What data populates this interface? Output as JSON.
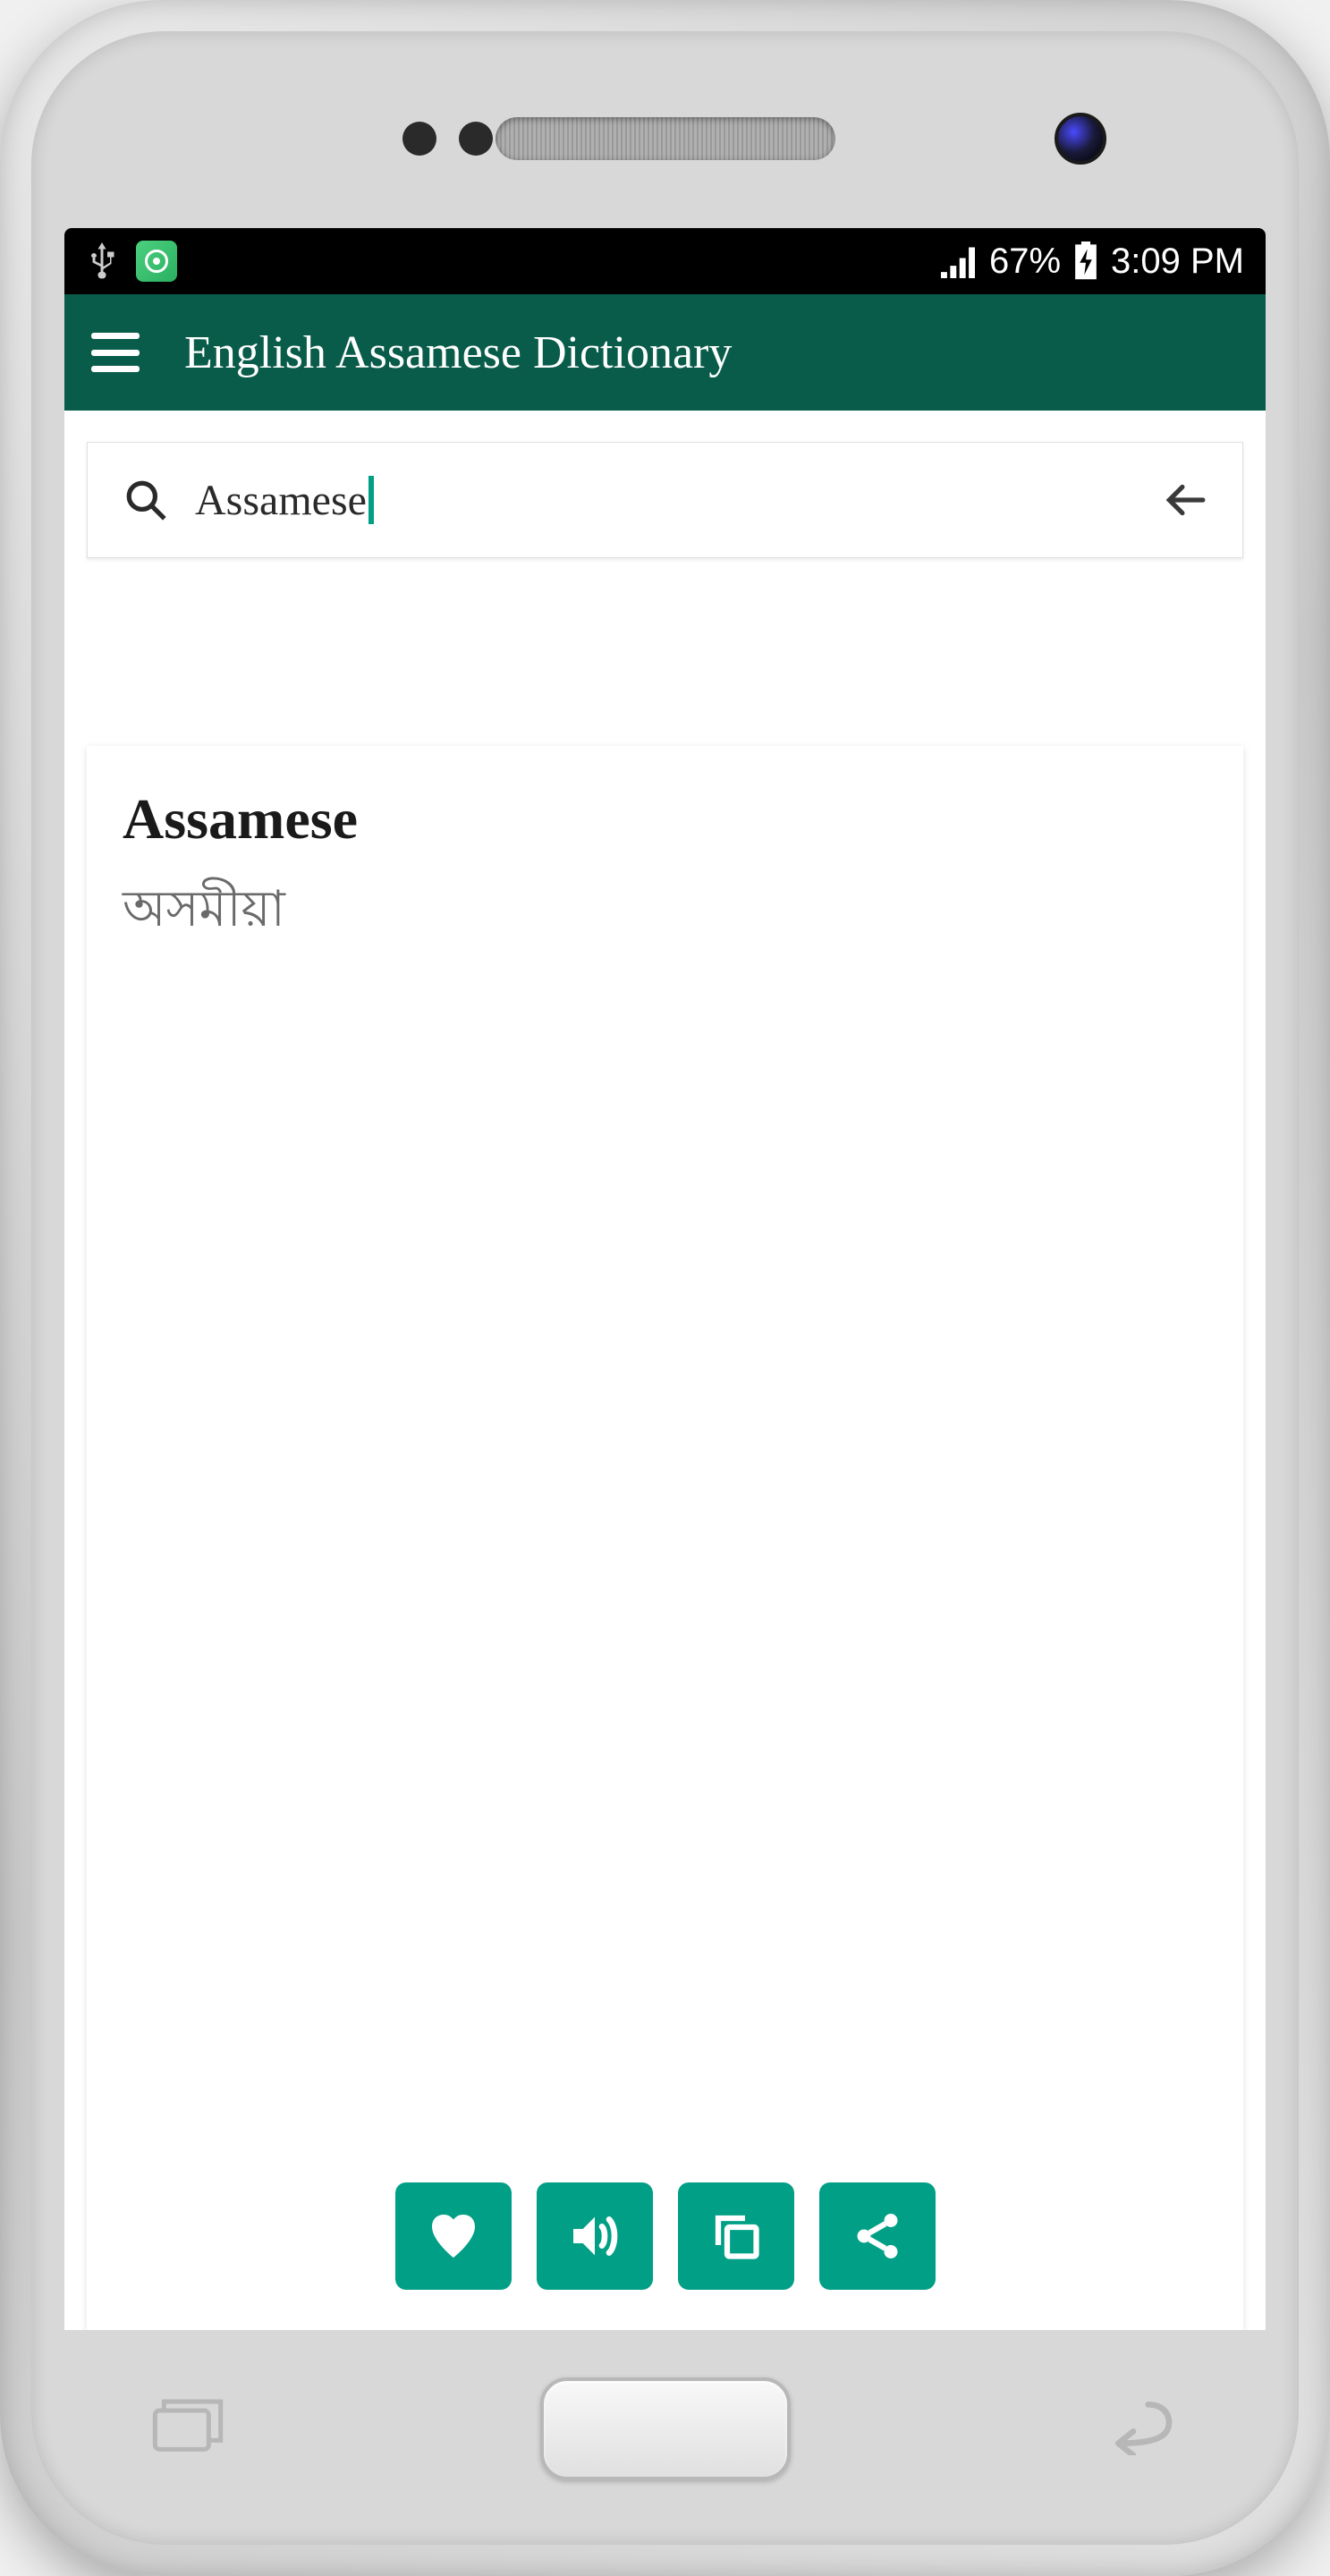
{
  "statusBar": {
    "batteryPercent": "67%",
    "time": "3:09 PM"
  },
  "header": {
    "title": "English Assamese Dictionary"
  },
  "search": {
    "value": "Assamese"
  },
  "result": {
    "word": "Assamese",
    "translation": "অসমীয়া"
  },
  "colors": {
    "primary": "#0a5c4a",
    "accent": "#009f86"
  }
}
